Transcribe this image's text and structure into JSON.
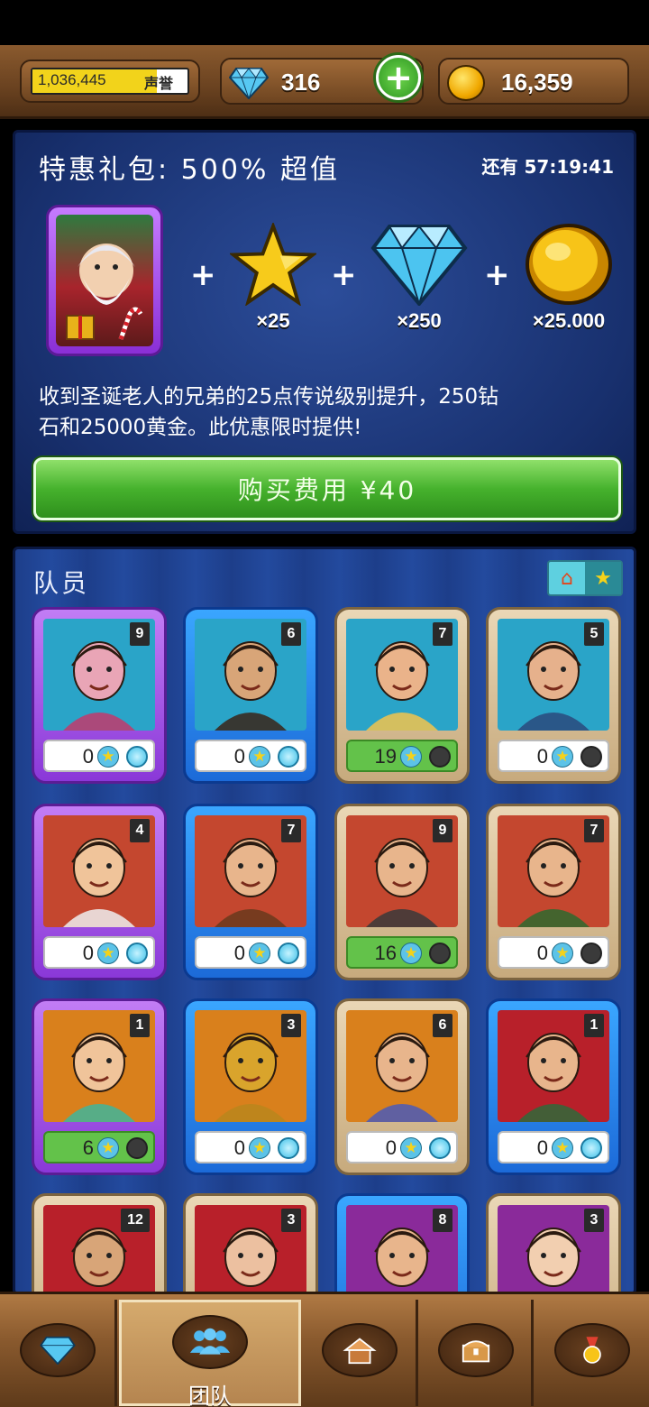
{
  "header": {
    "reputation_value": "1,036,445",
    "reputation_label": "声誉",
    "reputation_progress": 0.8,
    "gems": "316",
    "gold": "16,359"
  },
  "offer": {
    "title": "特惠礼包: 500% 超值",
    "timer": "还有 57:19:41",
    "rewards": [
      {
        "icon": "star-icon",
        "qty": "×25"
      },
      {
        "icon": "diamond-icon",
        "qty": "×250"
      },
      {
        "icon": "gold-coin-icon",
        "qty": "×25.000"
      }
    ],
    "description_line1": "收到圣诞老人的兄弟的25点传说级别提升，250钻",
    "description_line2": "石和25000黄金。此优惠限时提供!",
    "buy_label": "购买费用 ¥40"
  },
  "team": {
    "title": "队员",
    "heroes": [
      {
        "level": "9",
        "stars": "0",
        "active": true,
        "frame": "purple",
        "bg": "#2aa4c8",
        "tone": "#e9a5b6",
        "hair": "#c23a6c"
      },
      {
        "level": "6",
        "stars": "0",
        "active": true,
        "frame": "blue",
        "bg": "#2aa4c8",
        "tone": "#d8a578",
        "hair": "#3a2418"
      },
      {
        "level": "7",
        "stars": "19",
        "active": false,
        "frame": "tan",
        "bg": "#2aa4c8",
        "tone": "#eab38a",
        "hair": "#f2c44c"
      },
      {
        "level": "5",
        "stars": "0",
        "active": false,
        "frame": "tan",
        "bg": "#2aa4c8",
        "tone": "#e6b18c",
        "hair": "#2a4a7c"
      },
      {
        "level": "4",
        "stars": "0",
        "active": true,
        "frame": "purple",
        "bg": "#c4472f",
        "tone": "#f0c49a",
        "hair": "#eeeeee"
      },
      {
        "level": "7",
        "stars": "0",
        "active": true,
        "frame": "blue",
        "bg": "#c4472f",
        "tone": "#e8b58c",
        "hair": "#6a3a1c"
      },
      {
        "level": "9",
        "stars": "16",
        "active": false,
        "frame": "tan",
        "bg": "#c4472f",
        "tone": "#e8b58c",
        "hair": "#3a3a3a"
      },
      {
        "level": "7",
        "stars": "0",
        "active": false,
        "frame": "tan",
        "bg": "#c4472f",
        "tone": "#e8b58c",
        "hair": "#2e6a2e"
      },
      {
        "level": "1",
        "stars": "6",
        "active": false,
        "frame": "purple",
        "bg": "#d9801c",
        "tone": "#f0c49a",
        "hair": "#3fb59a"
      },
      {
        "level": "3",
        "stars": "0",
        "active": true,
        "frame": "blue",
        "bg": "#d9801c",
        "tone": "#d9a42c",
        "hair": "#b8861c"
      },
      {
        "level": "6",
        "stars": "0",
        "active": true,
        "frame": "tan",
        "bg": "#d9801c",
        "tone": "#e8b58c",
        "hair": "#4a5ab8"
      },
      {
        "level": "1",
        "stars": "0",
        "active": true,
        "frame": "blue",
        "bg": "#b8202a",
        "tone": "#e8b58c",
        "hair": "#2e6a3a"
      },
      {
        "level": "12",
        "stars": "",
        "active": false,
        "frame": "tan",
        "bg": "#b8202a",
        "tone": "#d8a578",
        "hair": "#4a2418"
      },
      {
        "level": "3",
        "stars": "",
        "active": false,
        "frame": "tan",
        "bg": "#b8202a",
        "tone": "#ecc0a0",
        "hair": "#c8c8dc"
      },
      {
        "level": "8",
        "stars": "",
        "active": false,
        "frame": "blue",
        "bg": "#8a2a9a",
        "tone": "#e8b58c",
        "hair": "#d8d8d8"
      },
      {
        "level": "3",
        "stars": "",
        "active": false,
        "frame": "tan",
        "bg": "#8a2a9a",
        "tone": "#f2cfb0",
        "hair": "#f3e6a8"
      }
    ]
  },
  "nav": {
    "items": [
      {
        "icon": "diamond-icon",
        "label": ""
      },
      {
        "icon": "team-icon",
        "label": "团队"
      },
      {
        "icon": "house-icon",
        "label": ""
      },
      {
        "icon": "chest-icon",
        "label": ""
      },
      {
        "icon": "medal-icon",
        "label": ""
      }
    ]
  },
  "colors": {
    "accent_green": "#46b22d",
    "panel_blue": "#18306e",
    "wood": "#8a5a2e"
  }
}
